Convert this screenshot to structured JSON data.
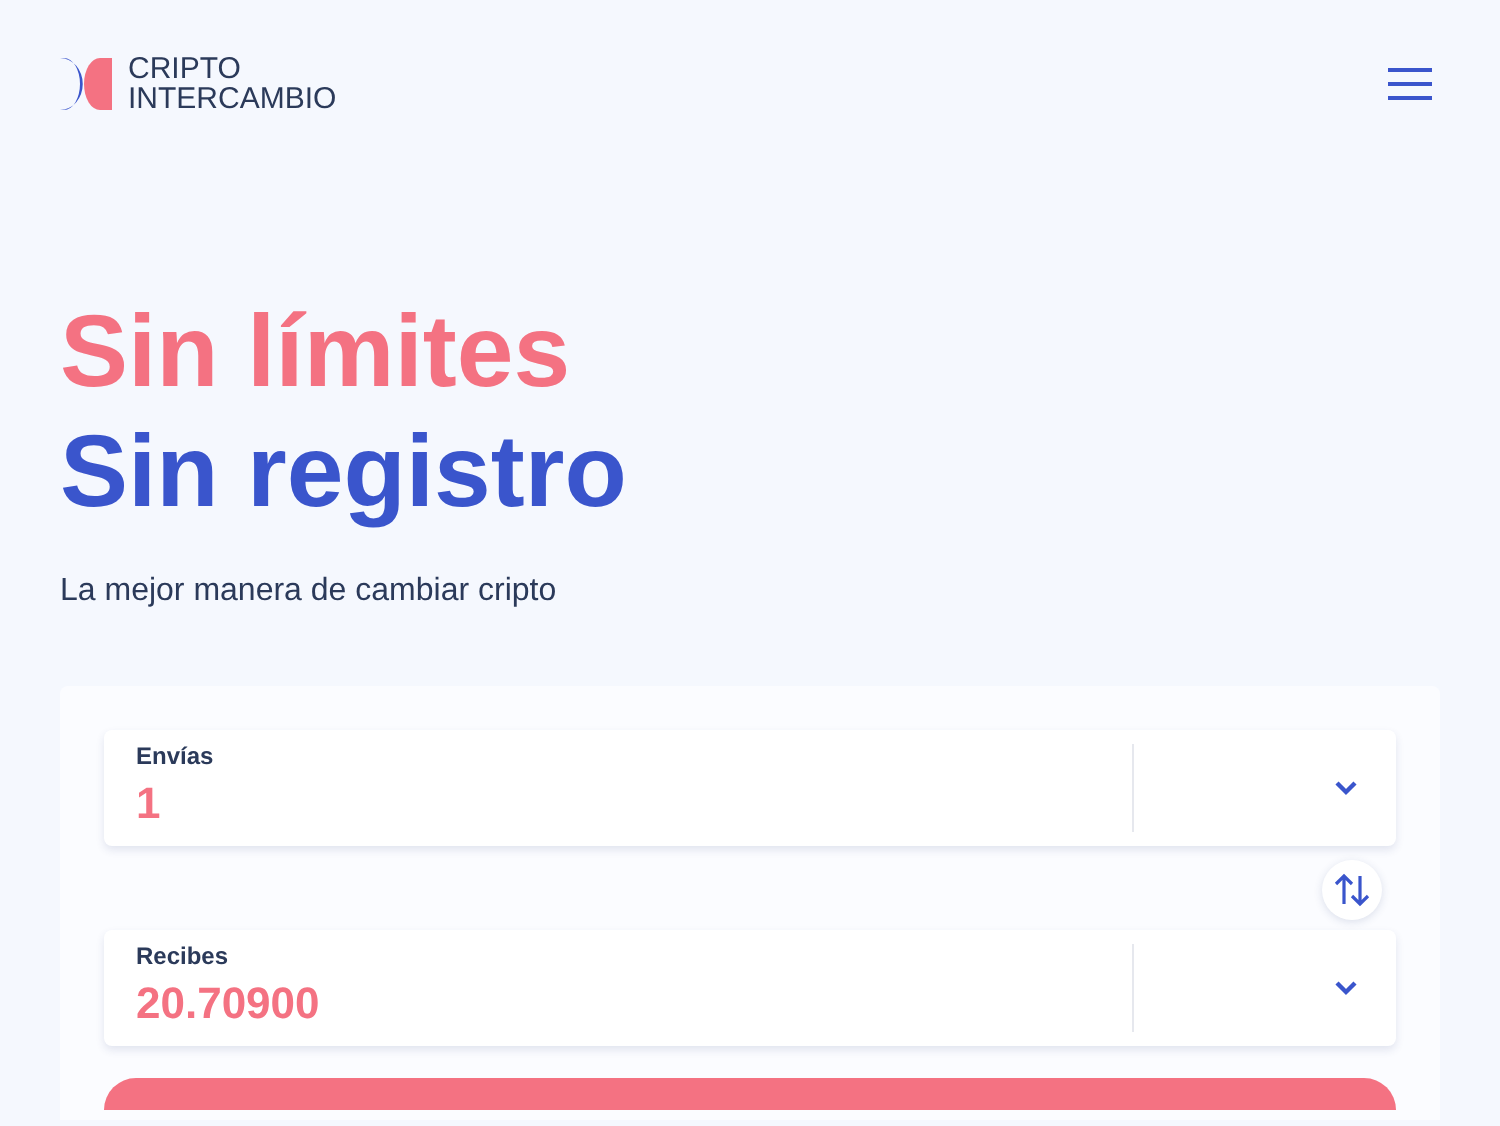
{
  "header": {
    "logo_lines": [
      "CRIPTO",
      "INTERCAMBIO"
    ]
  },
  "hero": {
    "title_lines": [
      {
        "text": "Sin límites",
        "kind": "accent"
      },
      {
        "text": "Sin registro",
        "kind": "primary"
      }
    ],
    "subtitle": "La mejor manera de cambiar cripto"
  },
  "exchange": {
    "fields": [
      {
        "label": "Envías",
        "value": "1"
      },
      {
        "label": "Recibes",
        "value": "20.70900"
      }
    ]
  }
}
